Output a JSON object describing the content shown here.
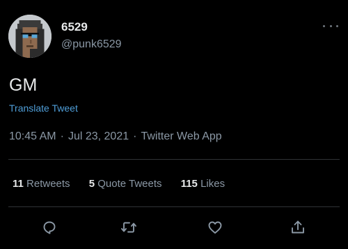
{
  "user": {
    "display_name": "6529",
    "handle": "@punk6529",
    "avatar_icon": "cryptopunk-avatar"
  },
  "tweet": {
    "text": "GM",
    "translate_label": "Translate Tweet",
    "time": "10:45 AM",
    "date": "Jul 23, 2021",
    "source": "Twitter Web App",
    "separator": "·"
  },
  "stats": {
    "retweets": {
      "count": "11",
      "label": "Retweets"
    },
    "quotes": {
      "count": "5",
      "label": "Quote Tweets"
    },
    "likes": {
      "count": "115",
      "label": "Likes"
    }
  },
  "actions": [
    "reply-icon",
    "retweet-icon",
    "like-icon",
    "share-icon"
  ],
  "colors": {
    "background": "#000000",
    "text": "#e7e9ea",
    "secondary": "#8b98a5",
    "link": "#4f9ed8",
    "divider": "#2f3336"
  }
}
